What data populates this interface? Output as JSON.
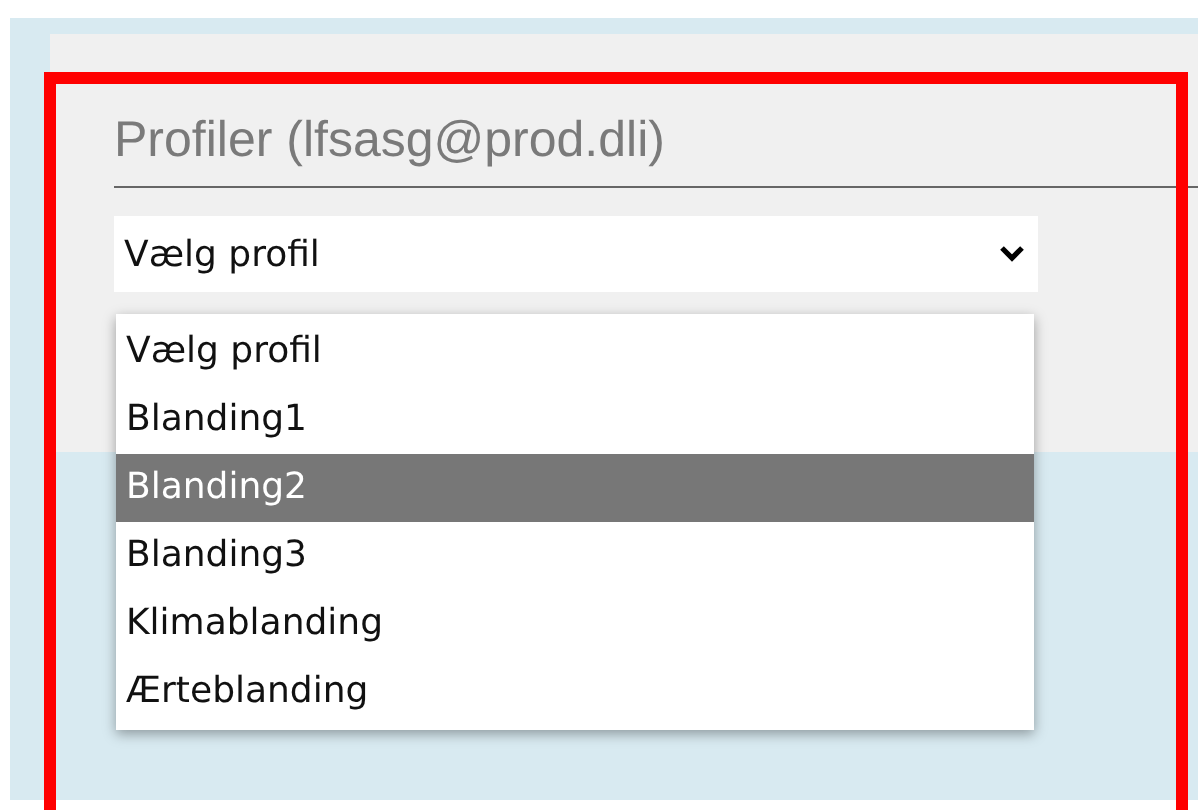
{
  "title": "Profiler (lfsasg@prod.dli)",
  "select": {
    "value": "Vælg profil",
    "expanded": true
  },
  "options": [
    {
      "label": "Vælg profil",
      "selected": false
    },
    {
      "label": "Blanding1",
      "selected": false
    },
    {
      "label": "Blanding2",
      "selected": true
    },
    {
      "label": "Blanding3",
      "selected": false
    },
    {
      "label": "Klimablanding",
      "selected": false
    },
    {
      "label": "Ærteblanding",
      "selected": false
    }
  ]
}
